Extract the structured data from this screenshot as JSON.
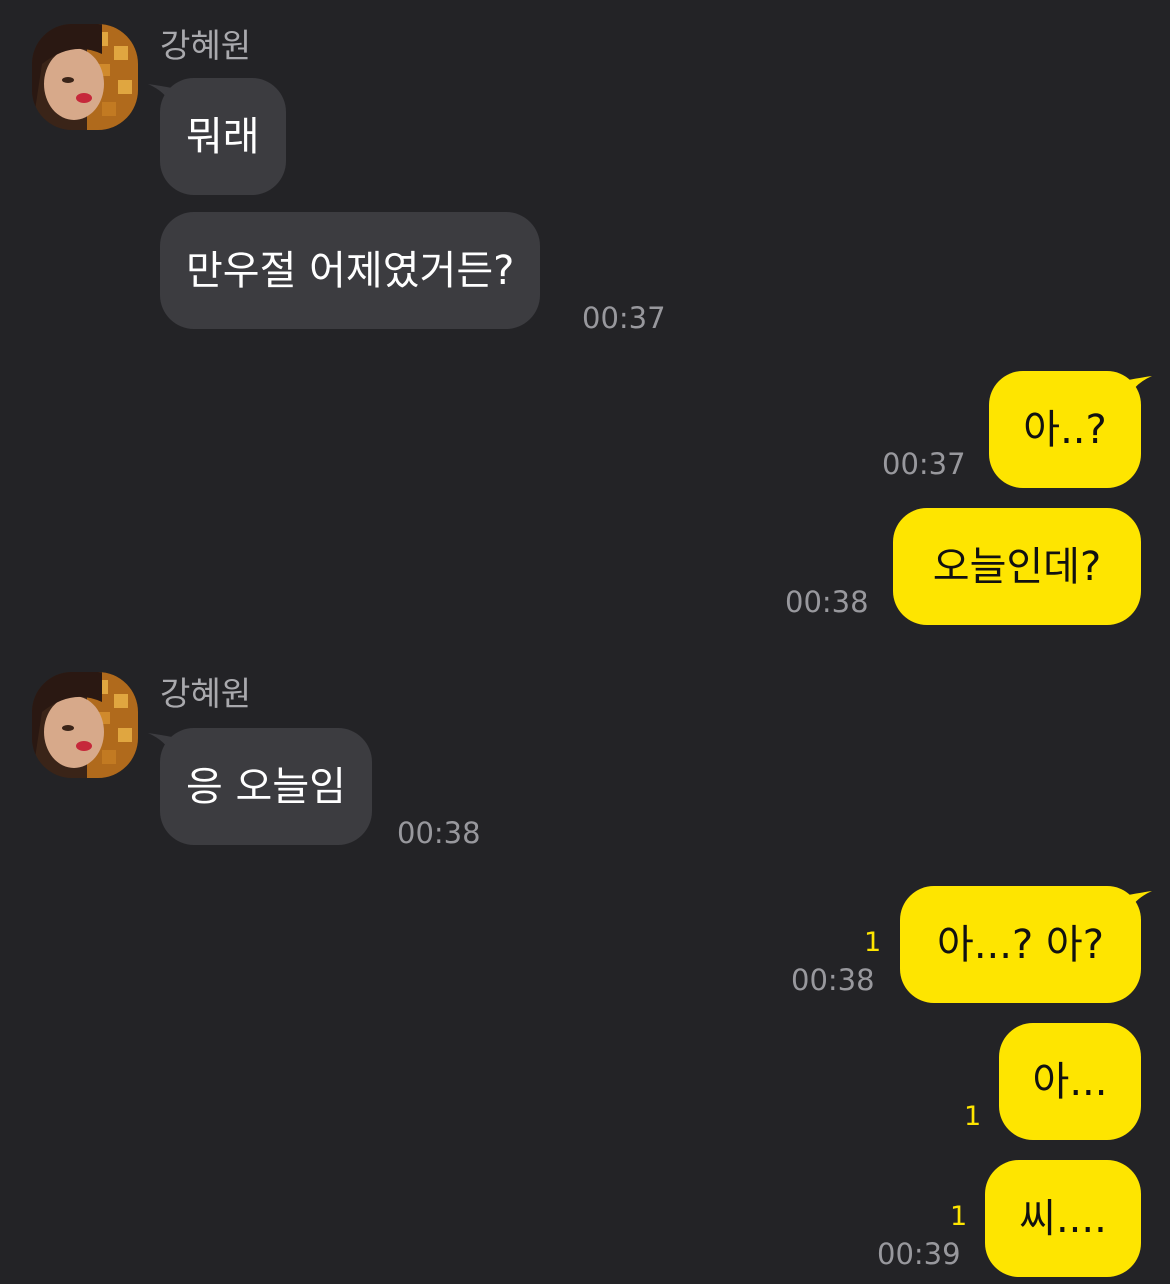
{
  "chat": {
    "colors": {
      "background": "#232326",
      "incoming_bubble": "#3c3c40",
      "outgoing_bubble": "#fee500",
      "unread_count": "#fee500",
      "timestamp": "#98989d"
    },
    "group1": {
      "sender": "강혜원",
      "avatar_icon": "profile-photo",
      "messages": [
        {
          "text": "뭐래"
        },
        {
          "text": "만우절 어제였거든?",
          "time": "00:37"
        }
      ]
    },
    "group2": {
      "messages": [
        {
          "text": "아..?",
          "time": "00:37"
        },
        {
          "text": "오늘인데?",
          "time": "00:38"
        }
      ]
    },
    "group3": {
      "sender": "강혜원",
      "avatar_icon": "profile-photo",
      "messages": [
        {
          "text": "응 오늘임",
          "time": "00:38"
        }
      ]
    },
    "group4": {
      "messages": [
        {
          "text": "아...? 아?",
          "unread": "1",
          "time": "00:38"
        },
        {
          "text": "아...",
          "unread": "1"
        },
        {
          "text": "씨....",
          "unread": "1",
          "time": "00:39"
        }
      ]
    }
  }
}
